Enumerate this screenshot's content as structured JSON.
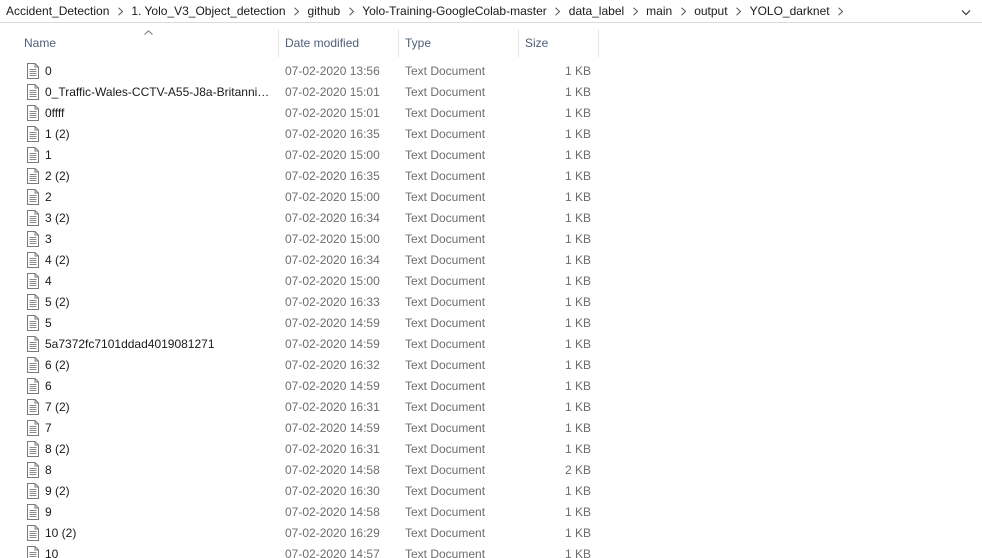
{
  "breadcrumb": [
    "Accident_Detection",
    "1. Yolo_V3_Object_detection",
    "github",
    "Yolo-Training-GoogleColab-master",
    "data_label",
    "main",
    "output",
    "YOLO_darknet"
  ],
  "icons": {
    "breadcrumb_separator": "chevron-right-icon",
    "address_dropdown": "chevron-down-icon",
    "sort": "sort-up-icon",
    "file": "text-document-icon"
  },
  "columns": {
    "name": "Name",
    "date": "Date modified",
    "type": "Type",
    "size": "Size"
  },
  "files": [
    {
      "name": "0",
      "date": "07-02-2020 13:56",
      "type": "Text Document",
      "size": "1 KB"
    },
    {
      "name": "0_Traffic-Wales-CCTV-A55-J8a-Britannia...",
      "date": "07-02-2020 15:01",
      "type": "Text Document",
      "size": "1 KB"
    },
    {
      "name": "0ffff",
      "date": "07-02-2020 15:01",
      "type": "Text Document",
      "size": "1 KB"
    },
    {
      "name": "1 (2)",
      "date": "07-02-2020 16:35",
      "type": "Text Document",
      "size": "1 KB"
    },
    {
      "name": "1",
      "date": "07-02-2020 15:00",
      "type": "Text Document",
      "size": "1 KB"
    },
    {
      "name": "2 (2)",
      "date": "07-02-2020 16:35",
      "type": "Text Document",
      "size": "1 KB"
    },
    {
      "name": "2",
      "date": "07-02-2020 15:00",
      "type": "Text Document",
      "size": "1 KB"
    },
    {
      "name": "3 (2)",
      "date": "07-02-2020 16:34",
      "type": "Text Document",
      "size": "1 KB"
    },
    {
      "name": "3",
      "date": "07-02-2020 15:00",
      "type": "Text Document",
      "size": "1 KB"
    },
    {
      "name": "4 (2)",
      "date": "07-02-2020 16:34",
      "type": "Text Document",
      "size": "1 KB"
    },
    {
      "name": "4",
      "date": "07-02-2020 15:00",
      "type": "Text Document",
      "size": "1 KB"
    },
    {
      "name": "5 (2)",
      "date": "07-02-2020 16:33",
      "type": "Text Document",
      "size": "1 KB"
    },
    {
      "name": "5",
      "date": "07-02-2020 14:59",
      "type": "Text Document",
      "size": "1 KB"
    },
    {
      "name": "5a7372fc7101ddad4019081271",
      "date": "07-02-2020 14:59",
      "type": "Text Document",
      "size": "1 KB"
    },
    {
      "name": "6 (2)",
      "date": "07-02-2020 16:32",
      "type": "Text Document",
      "size": "1 KB"
    },
    {
      "name": "6",
      "date": "07-02-2020 14:59",
      "type": "Text Document",
      "size": "1 KB"
    },
    {
      "name": "7 (2)",
      "date": "07-02-2020 16:31",
      "type": "Text Document",
      "size": "1 KB"
    },
    {
      "name": "7",
      "date": "07-02-2020 14:59",
      "type": "Text Document",
      "size": "1 KB"
    },
    {
      "name": "8 (2)",
      "date": "07-02-2020 16:31",
      "type": "Text Document",
      "size": "1 KB"
    },
    {
      "name": "8",
      "date": "07-02-2020 14:58",
      "type": "Text Document",
      "size": "2 KB"
    },
    {
      "name": "9 (2)",
      "date": "07-02-2020 16:30",
      "type": "Text Document",
      "size": "1 KB"
    },
    {
      "name": "9",
      "date": "07-02-2020 14:58",
      "type": "Text Document",
      "size": "1 KB"
    },
    {
      "name": "10 (2)",
      "date": "07-02-2020 16:29",
      "type": "Text Document",
      "size": "1 KB"
    },
    {
      "name": "10",
      "date": "07-02-2020 14:57",
      "type": "Text Document",
      "size": "1 KB"
    }
  ]
}
